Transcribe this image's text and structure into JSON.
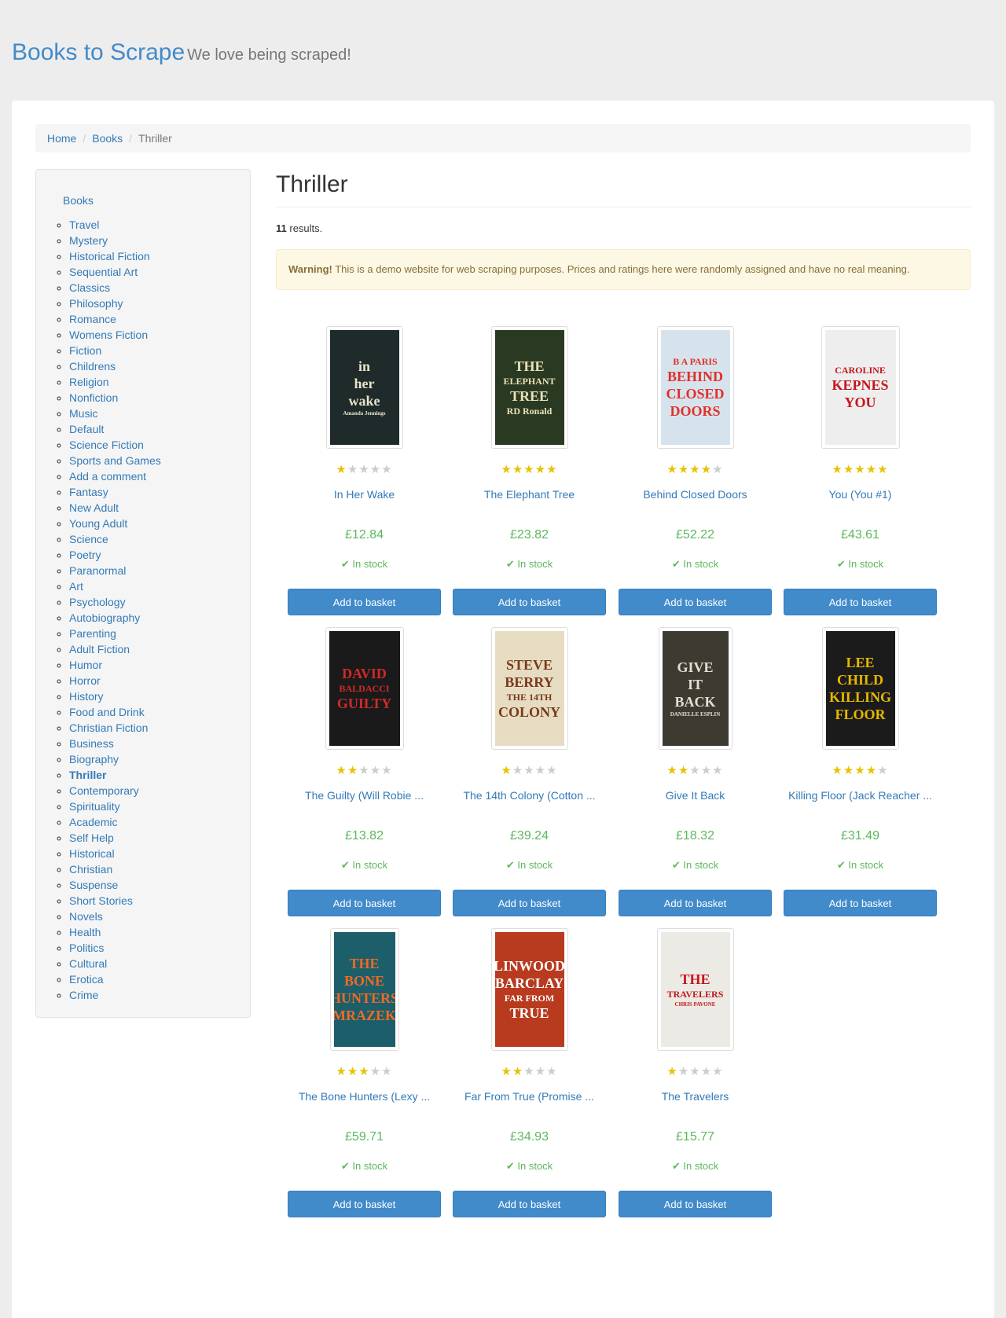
{
  "header": {
    "brand_name": "Books to Scrape",
    "tagline": "We love being scraped!"
  },
  "breadcrumb": {
    "home": "Home",
    "books": "Books",
    "current": "Thriller"
  },
  "sidebar": {
    "root": "Books",
    "categories": [
      "Travel",
      "Mystery",
      "Historical Fiction",
      "Sequential Art",
      "Classics",
      "Philosophy",
      "Romance",
      "Womens Fiction",
      "Fiction",
      "Childrens",
      "Religion",
      "Nonfiction",
      "Music",
      "Default",
      "Science Fiction",
      "Sports and Games",
      "Add a comment",
      "Fantasy",
      "New Adult",
      "Young Adult",
      "Science",
      "Poetry",
      "Paranormal",
      "Art",
      "Psychology",
      "Autobiography",
      "Parenting",
      "Adult Fiction",
      "Humor",
      "Horror",
      "History",
      "Food and Drink",
      "Christian Fiction",
      "Business",
      "Biography",
      "Thriller",
      "Contemporary",
      "Spirituality",
      "Academic",
      "Self Help",
      "Historical",
      "Christian",
      "Suspense",
      "Short Stories",
      "Novels",
      "Health",
      "Politics",
      "Cultural",
      "Erotica",
      "Crime"
    ],
    "current": "Thriller"
  },
  "main": {
    "heading": "Thriller",
    "results_count": "11",
    "results_suffix": " results.",
    "warning_strong": "Warning!",
    "warning_text": " This is a demo website for web scraping purposes. Prices and ratings here were randomly assigned and have no real meaning."
  },
  "stock_label": "In stock",
  "button_label": "Add to basket",
  "colors": {
    "accent": "#428bca",
    "price": "#5cb85c",
    "star": "#e6c300",
    "warning_bg": "#fcf8e3"
  },
  "books": [
    {
      "title": "In Her Wake",
      "rating": 1,
      "price": "£12.84",
      "cover_bg": "#1f2a2b",
      "cover_fg": "#e8e4c9",
      "cover_text": [
        "in",
        "her",
        "wake",
        "Amanda Jennings"
      ]
    },
    {
      "title": "The Elephant Tree",
      "rating": 5,
      "price": "£23.82",
      "cover_bg": "#2a3a22",
      "cover_fg": "#e9e0b8",
      "cover_text": [
        "THE",
        "ELEPHANT",
        "TREE",
        "RD Ronald"
      ]
    },
    {
      "title": "Behind Closed Doors",
      "rating": 4,
      "price": "£52.22",
      "cover_bg": "#d7e3ec",
      "cover_fg": "#e0302a",
      "cover_text": [
        "B A PARIS",
        "BEHIND",
        "CLOSED",
        "DOORS"
      ]
    },
    {
      "title": "You (You #1)",
      "rating": 5,
      "price": "£43.61",
      "cover_bg": "#eeeeee",
      "cover_fg": "#c4161c",
      "cover_text": [
        "CAROLINE",
        "KEPNES",
        "YOU"
      ]
    },
    {
      "title": "The Guilty (Will Robie ...",
      "rating": 2,
      "price": "£13.82",
      "cover_bg": "#1a1a1a",
      "cover_fg": "#d12a2a",
      "cover_text": [
        "DAVID",
        "BALDACCI",
        "GUILTY"
      ]
    },
    {
      "title": "The 14th Colony (Cotton ...",
      "rating": 1,
      "price": "£39.24",
      "cover_bg": "#e6dcc2",
      "cover_fg": "#7a3a1a",
      "cover_text": [
        "STEVE",
        "BERRY",
        "THE 14TH",
        "COLONY"
      ]
    },
    {
      "title": "Give It Back",
      "rating": 2,
      "price": "£18.32",
      "cover_bg": "#3d3b31",
      "cover_fg": "#e3dfd0",
      "cover_text": [
        "GIVE",
        "IT",
        "BACK",
        "DANIELLE ESPLIN"
      ]
    },
    {
      "title": "Killing Floor (Jack Reacher ...",
      "rating": 4,
      "price": "£31.49",
      "cover_bg": "#1b1b1b",
      "cover_fg": "#e6b800",
      "cover_text": [
        "LEE",
        "CHILD",
        "KILLING",
        "FLOOR"
      ]
    },
    {
      "title": "The Bone Hunters (Lexy ...",
      "rating": 3,
      "price": "£59.71",
      "cover_bg": "#1c5f6b",
      "cover_fg": "#f06a23",
      "cover_text": [
        "THE",
        "BONE",
        "HUNTERS",
        "MRAZEK"
      ]
    },
    {
      "title": "Far From True (Promise ...",
      "rating": 2,
      "price": "£34.93",
      "cover_bg": "#b83a1f",
      "cover_fg": "#ffffff",
      "cover_text": [
        "LINWOOD",
        "BARCLAY",
        "FAR FROM",
        "TRUE"
      ]
    },
    {
      "title": "The Travelers",
      "rating": 1,
      "price": "£15.77",
      "cover_bg": "#eceae4",
      "cover_fg": "#c4161c",
      "cover_text": [
        "THE",
        "TRAVELERS",
        "CHRIS PAVONE"
      ]
    }
  ]
}
